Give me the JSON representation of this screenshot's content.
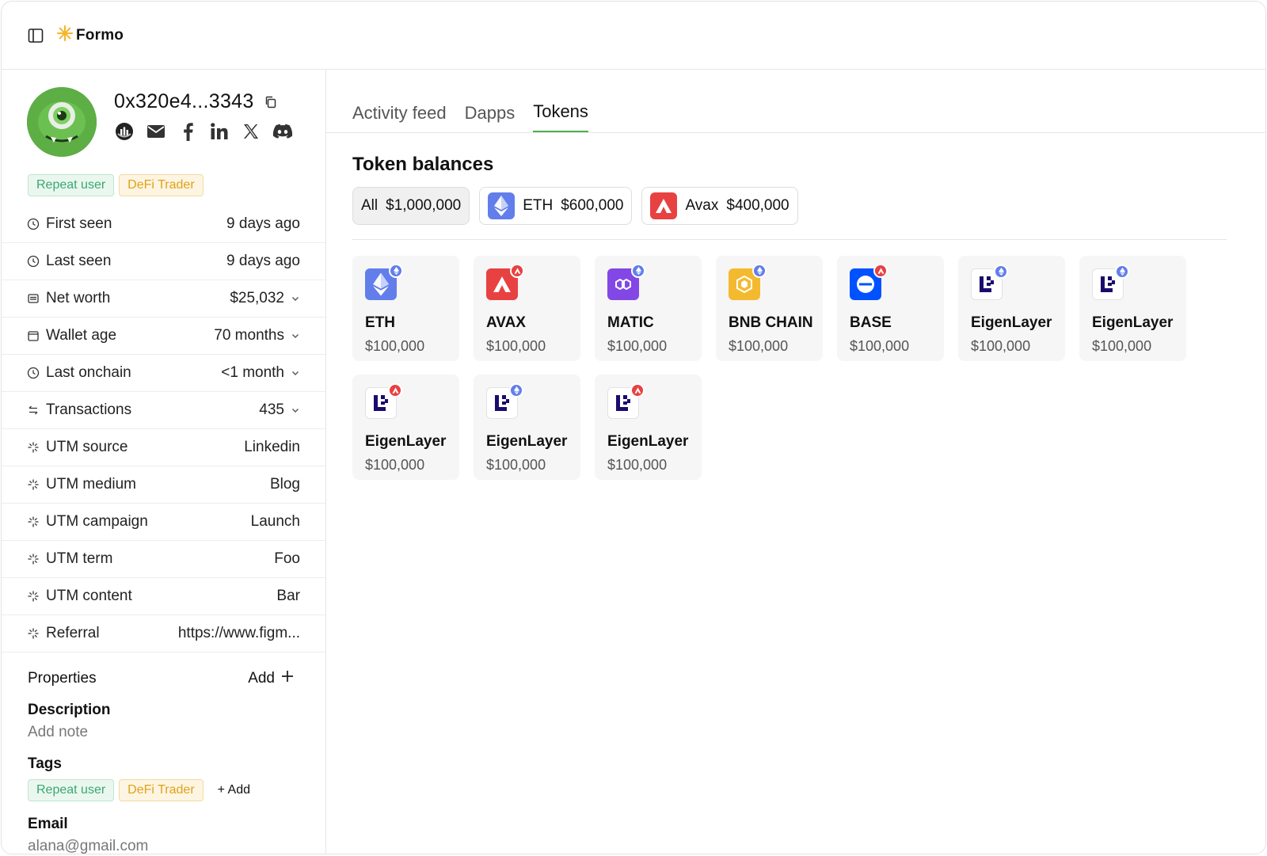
{
  "brand": {
    "name": "Formo"
  },
  "profile": {
    "address": "0x320e4...3343",
    "badges": [
      "Repeat user",
      "DeFi Trader"
    ]
  },
  "attributes": [
    {
      "label": "First seen",
      "value": "9 days ago",
      "icon": "clock-icon",
      "chevron": false
    },
    {
      "label": "Last seen",
      "value": "9 days ago",
      "icon": "clock-icon",
      "chevron": false
    },
    {
      "label": "Net worth",
      "value": "$25,032",
      "icon": "wallet-icon",
      "chevron": true
    },
    {
      "label": "Wallet age",
      "value": "70 months",
      "icon": "calendar-icon",
      "chevron": true
    },
    {
      "label": "Last onchain",
      "value": "<1 month",
      "icon": "clock-icon",
      "chevron": true
    },
    {
      "label": "Transactions",
      "value": "435",
      "icon": "arrows-icon",
      "chevron": true
    },
    {
      "label": "UTM source",
      "value": "Linkedin",
      "icon": "sparkle-icon",
      "chevron": false
    },
    {
      "label": "UTM medium",
      "value": "Blog",
      "icon": "sparkle-icon",
      "chevron": false
    },
    {
      "label": "UTM campaign",
      "value": "Launch",
      "icon": "sparkle-icon",
      "chevron": false
    },
    {
      "label": "UTM term",
      "value": "Foo",
      "icon": "sparkle-icon",
      "chevron": false
    },
    {
      "label": "UTM content",
      "value": "Bar",
      "icon": "sparkle-icon",
      "chevron": false
    },
    {
      "label": "Referral",
      "value": "https://www.figm...",
      "icon": "sparkle-icon",
      "chevron": false
    }
  ],
  "properties": {
    "title": "Properties",
    "add_label": "Add"
  },
  "description": {
    "title": "Description",
    "placeholder": "Add note"
  },
  "tags": {
    "title": "Tags",
    "items": [
      "Repeat user",
      "DeFi Trader"
    ],
    "add_label": "+ Add"
  },
  "email": {
    "title": "Email",
    "value": "alana@gmail.com"
  },
  "tabs": [
    {
      "label": "Activity feed",
      "active": false
    },
    {
      "label": "Dapps",
      "active": false
    },
    {
      "label": "Tokens",
      "active": true
    }
  ],
  "balances": {
    "title": "Token balances",
    "filters": [
      {
        "label": "All",
        "amount": "$1,000,000",
        "active": true,
        "icon": ""
      },
      {
        "label": "ETH",
        "amount": "$600,000",
        "active": false,
        "icon": "eth-icon"
      },
      {
        "label": "Avax",
        "amount": "$400,000",
        "active": false,
        "icon": "avax-icon"
      }
    ],
    "tokens": [
      {
        "name": "ETH",
        "value": "$100,000",
        "icon": "eth-icon",
        "chain": "eth"
      },
      {
        "name": "AVAX",
        "value": "$100,000",
        "icon": "avax-icon",
        "chain": "avax"
      },
      {
        "name": "MATIC",
        "value": "$100,000",
        "icon": "matic-icon",
        "chain": "eth"
      },
      {
        "name": "BNB CHAIN",
        "value": "$100,000",
        "icon": "bnb-icon",
        "chain": "eth"
      },
      {
        "name": "BASE",
        "value": "$100,000",
        "icon": "base-icon",
        "chain": "avax"
      },
      {
        "name": "EigenLayer",
        "value": "$100,000",
        "icon": "eigenlayer-icon",
        "chain": "eth"
      },
      {
        "name": "EigenLayer",
        "value": "$100,000",
        "icon": "eigenlayer-icon",
        "chain": "eth"
      },
      {
        "name": "EigenLayer",
        "value": "$100,000",
        "icon": "eigenlayer-icon",
        "chain": "avax"
      },
      {
        "name": "EigenLayer",
        "value": "$100,000",
        "icon": "eigenlayer-icon",
        "chain": "eth"
      },
      {
        "name": "EigenLayer",
        "value": "$100,000",
        "icon": "eigenlayer-icon",
        "chain": "avax"
      }
    ]
  },
  "colors": {
    "accent": "#4caf50",
    "eth": "#627eea",
    "avax": "#e84142",
    "matic": "#8247e5",
    "bnb": "#f3ba2f",
    "base": "#0052ff",
    "eigen": "#1a0c6d"
  }
}
